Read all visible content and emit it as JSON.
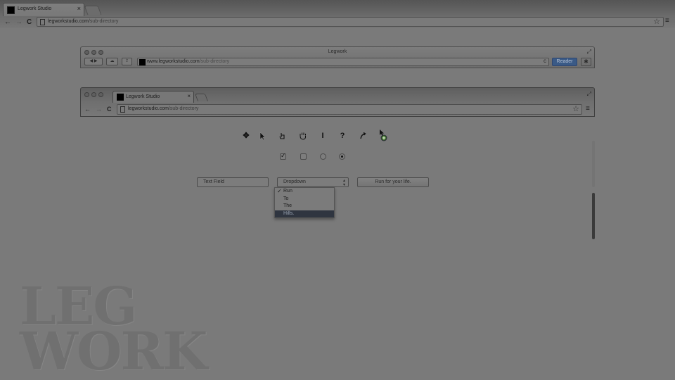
{
  "outer_browser": {
    "tab_title": "Legwork Studio",
    "tab_close": "×",
    "url_host": "legworkstudio.com",
    "url_path": "/sub-directory",
    "back": "←",
    "forward": "→",
    "reload": "C",
    "star": "☆",
    "menu": "≡"
  },
  "safari_mock": {
    "title": "Legwork",
    "back_forward": "◀ ▶",
    "url_host": "www.legworkstudio.com",
    "url_path": "/sub-directory",
    "reload": "c",
    "reader_label": "Reader",
    "gear": "✱",
    "expand": "⤢"
  },
  "chrome_mock": {
    "tab_title": "Legwork Studio",
    "tab_close": "×",
    "url_host": "legworkstudio.com",
    "url_path": "/sub-directory",
    "back": "←",
    "forward": "→",
    "reload": "C",
    "star": "☆",
    "menu": "≡",
    "expand": "⤢"
  },
  "cursors": {
    "move": "✥",
    "help": "?",
    "text": "I"
  },
  "controls": {
    "checkbox_checked": true,
    "checkbox_unchecked": false,
    "radio_unchecked": false,
    "radio_checked": true
  },
  "form": {
    "text_field_placeholder": "Text Field",
    "dropdown_label": "Dropdown",
    "dropdown_arrows": "▲▼",
    "button_label": "Run for your life.",
    "dropdown_options": [
      "Run",
      "To",
      "The",
      "Hills."
    ],
    "selected_option": "Run",
    "highlighted_option": "Hills."
  },
  "logo": {
    "line1": "LEG",
    "line2": "WORK"
  },
  "colors": {
    "reader_blue": "#3a5a86",
    "highlight": "#2f3540",
    "overlay_gray": "#7a7a7a"
  }
}
